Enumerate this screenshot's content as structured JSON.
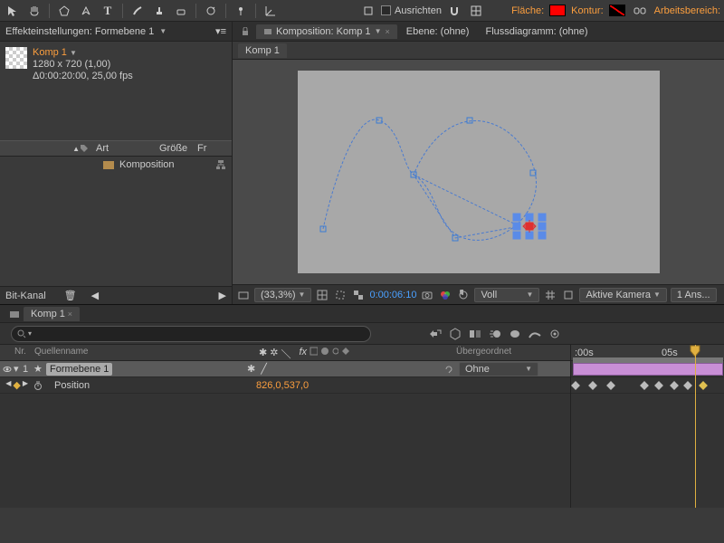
{
  "toolbar": {
    "align_label": "Ausrichten",
    "fill_label": "Fläche:",
    "stroke_label": "Kontur:",
    "stroke_value": "",
    "workspace_label": "Arbeitsbereich:",
    "fill_color": "#ff0000",
    "stroke_color": "#000000"
  },
  "project_panel": {
    "tab": "Effekteinstellungen: Formebene 1",
    "comp_name": "Komp 1",
    "resolution": "1280 x 720 (1,00)",
    "duration": "Δ0:00:20:00, 25,00 fps",
    "columns": {
      "type": "Art",
      "size": "Größe",
      "fr": "Fr"
    },
    "item_type": "Komposition",
    "bit_label": "Bit-Kanal"
  },
  "viewer": {
    "tabs": {
      "composition": "Komposition: Komp 1",
      "layer": "Ebene: (ohne)",
      "flowchart": "Flussdiagramm: (ohne)"
    },
    "subtab": "Komp 1",
    "zoom": "(33,3%)",
    "timecode": "0:00:06:10",
    "resolution": "Voll",
    "camera": "Aktive Kamera",
    "views": "1 Ans..."
  },
  "timeline": {
    "tab": "Komp 1",
    "columns": {
      "nr": "Nr.",
      "source": "Quellenname",
      "parent": "Übergeordnet"
    },
    "parent_value": "Ohne",
    "ruler": {
      "t0": ":00s",
      "t1": "05s"
    },
    "layer": {
      "index": "1",
      "name": "Formebene 1",
      "prop": "Position",
      "value": "826,0,537,0"
    },
    "keyframes_pct": [
      3,
      14,
      26,
      48,
      58,
      68,
      77,
      87
    ]
  }
}
